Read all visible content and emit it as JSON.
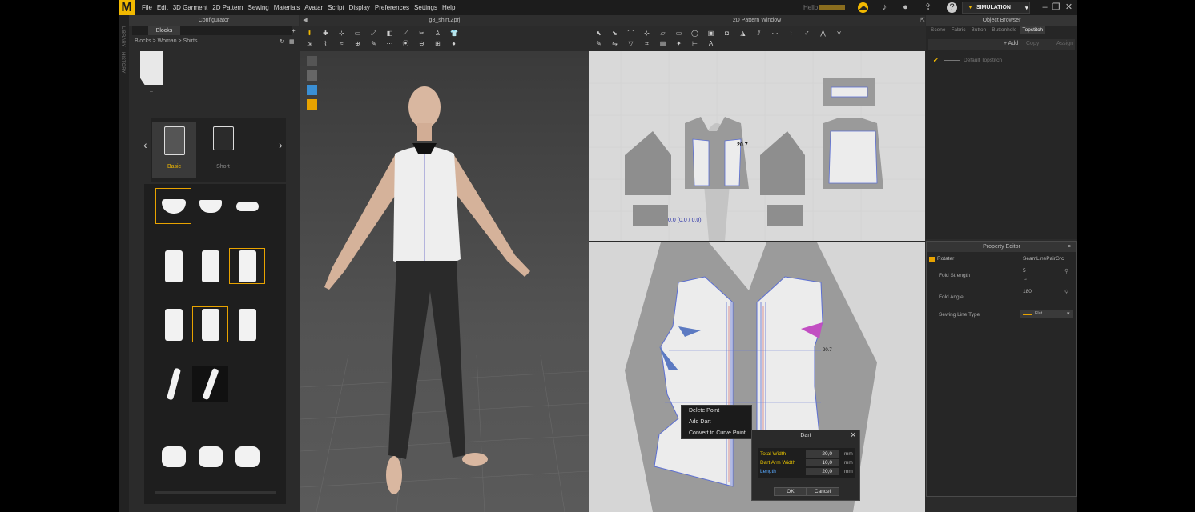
{
  "menu": {
    "logo": "M",
    "items": [
      "File",
      "Edit",
      "3D Garment",
      "2D Pattern",
      "Sewing",
      "Materials",
      "Avatar",
      "Script",
      "Display",
      "Preferences",
      "Settings",
      "Help"
    ]
  },
  "topbar": {
    "hello": "Hello",
    "mode": "SIMULATION"
  },
  "sidebar_strip": {
    "library": "LIBRARY",
    "history": "HISTORY"
  },
  "configurator": {
    "title": "Configurator",
    "tab": "Blocks",
    "path": "Blocks > Woman > Shirts",
    "folder_label": "..",
    "styles": [
      {
        "label": "Basic"
      },
      {
        "label": "Short"
      }
    ]
  },
  "view3d": {
    "title": "g8_shirt.Zprj"
  },
  "pattern_window": {
    "title": "2D Pattern Window",
    "coord_readout": "0.0 (0.0 / 0.0)",
    "measure_1": "20.7",
    "measure_2": "20.7"
  },
  "context_menu": {
    "items": [
      "Delete Point",
      "Add Dart",
      "Convert to Curve Point"
    ]
  },
  "dart_dialog": {
    "title": "Dart",
    "fields": [
      {
        "label": "Total Width",
        "value": "20,0",
        "unit": "mm",
        "color": "#e8c400"
      },
      {
        "label": "Dart Arm Width",
        "value": "10,0",
        "unit": "mm",
        "color": "#e8c400"
      },
      {
        "label": "Length",
        "value": "20,0",
        "unit": "mm",
        "color": "#58a9ff"
      }
    ],
    "ok": "OK",
    "cancel": "Cancel"
  },
  "object_browser": {
    "title": "Object Browser",
    "tabs": [
      "Scene",
      "Fabric",
      "Button",
      "Buttonhole",
      "Topstitch"
    ],
    "active_tab": "Topstitch",
    "add": "+ Add",
    "copy": "Copy",
    "assign": "Assign",
    "item": "Default Topstitch"
  },
  "property_editor": {
    "title": "Property Editor",
    "name_label": "Rotater",
    "name_value": "SeamLinePairGrc",
    "fold_strength_label": "Fold Strength",
    "fold_strength_value": "5",
    "fold_angle_label": "Fold Angle",
    "fold_angle_value": "180",
    "sewing_line_label": "Sewing Line Type",
    "sewing_line_value": "Flat"
  },
  "colors": {
    "accent": "#f2b900",
    "selection": "#e8a300"
  }
}
